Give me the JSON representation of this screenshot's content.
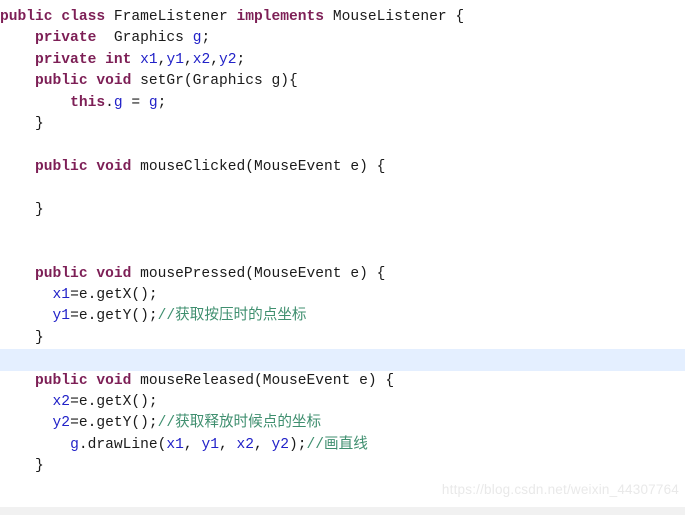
{
  "editor": {
    "language": "Java",
    "background_color": "#ffffff",
    "highlight_row_color": "#e4efff",
    "keyword_color": "#7d1f56",
    "variable_color": "#2222c8",
    "comment_color": "#3f8f6f",
    "plain_color": "#1a1a1a",
    "watermark_color": "#e9e9e9",
    "bottom_strip_color": "#f1f1f1",
    "highlighted_line_number": 17
  },
  "watermark": {
    "text": "https://blog.csdn.net/weixin_44307764"
  },
  "code": {
    "lines": [
      {
        "n": 1,
        "highlighted": false,
        "tokens": [
          {
            "t": "public",
            "c": "kw"
          },
          {
            "t": " ",
            "c": "pln"
          },
          {
            "t": "class",
            "c": "kw"
          },
          {
            "t": " FrameListener ",
            "c": "pln"
          },
          {
            "t": "implements",
            "c": "kw"
          },
          {
            "t": " MouseListener {",
            "c": "pln"
          }
        ]
      },
      {
        "n": 2,
        "highlighted": false,
        "tokens": [
          {
            "t": "    ",
            "c": "pln"
          },
          {
            "t": "private",
            "c": "kw"
          },
          {
            "t": "  Graphics ",
            "c": "pln"
          },
          {
            "t": "g",
            "c": "var"
          },
          {
            "t": ";",
            "c": "pln"
          }
        ]
      },
      {
        "n": 3,
        "highlighted": false,
        "tokens": [
          {
            "t": "    ",
            "c": "pln"
          },
          {
            "t": "private",
            "c": "kw"
          },
          {
            "t": " ",
            "c": "pln"
          },
          {
            "t": "int",
            "c": "kw"
          },
          {
            "t": " ",
            "c": "pln"
          },
          {
            "t": "x1",
            "c": "var"
          },
          {
            "t": ",",
            "c": "pln"
          },
          {
            "t": "y1",
            "c": "var"
          },
          {
            "t": ",",
            "c": "pln"
          },
          {
            "t": "x2",
            "c": "var"
          },
          {
            "t": ",",
            "c": "pln"
          },
          {
            "t": "y2",
            "c": "var"
          },
          {
            "t": ";",
            "c": "pln"
          }
        ]
      },
      {
        "n": 4,
        "highlighted": false,
        "tokens": [
          {
            "t": "    ",
            "c": "pln"
          },
          {
            "t": "public",
            "c": "kw"
          },
          {
            "t": " ",
            "c": "pln"
          },
          {
            "t": "void",
            "c": "kw"
          },
          {
            "t": " setGr(Graphics g){",
            "c": "pln"
          }
        ]
      },
      {
        "n": 5,
        "highlighted": false,
        "tokens": [
          {
            "t": "        ",
            "c": "pln"
          },
          {
            "t": "this",
            "c": "kw"
          },
          {
            "t": ".",
            "c": "pln"
          },
          {
            "t": "g",
            "c": "var"
          },
          {
            "t": " = ",
            "c": "pln"
          },
          {
            "t": "g",
            "c": "var"
          },
          {
            "t": ";",
            "c": "pln"
          }
        ]
      },
      {
        "n": 6,
        "highlighted": false,
        "tokens": [
          {
            "t": "    }",
            "c": "pln"
          }
        ]
      },
      {
        "n": 7,
        "highlighted": false,
        "tokens": [
          {
            "t": "",
            "c": "pln"
          }
        ]
      },
      {
        "n": 8,
        "highlighted": false,
        "tokens": [
          {
            "t": "    ",
            "c": "pln"
          },
          {
            "t": "public",
            "c": "kw"
          },
          {
            "t": " ",
            "c": "pln"
          },
          {
            "t": "void",
            "c": "kw"
          },
          {
            "t": " mouseClicked(MouseEvent e) {",
            "c": "pln"
          }
        ]
      },
      {
        "n": 9,
        "highlighted": false,
        "tokens": [
          {
            "t": "",
            "c": "pln"
          }
        ]
      },
      {
        "n": 10,
        "highlighted": false,
        "tokens": [
          {
            "t": "    }",
            "c": "pln"
          }
        ]
      },
      {
        "n": 11,
        "highlighted": false,
        "tokens": [
          {
            "t": "",
            "c": "pln"
          }
        ]
      },
      {
        "n": 12,
        "highlighted": false,
        "tokens": [
          {
            "t": "",
            "c": "pln"
          }
        ]
      },
      {
        "n": 13,
        "highlighted": false,
        "tokens": [
          {
            "t": "    ",
            "c": "pln"
          },
          {
            "t": "public",
            "c": "kw"
          },
          {
            "t": " ",
            "c": "pln"
          },
          {
            "t": "void",
            "c": "kw"
          },
          {
            "t": " mousePressed(MouseEvent e) {",
            "c": "pln"
          }
        ]
      },
      {
        "n": 14,
        "highlighted": false,
        "tokens": [
          {
            "t": "      ",
            "c": "pln"
          },
          {
            "t": "x1",
            "c": "var"
          },
          {
            "t": "=e.getX();",
            "c": "pln"
          }
        ]
      },
      {
        "n": 15,
        "highlighted": false,
        "tokens": [
          {
            "t": "      ",
            "c": "pln"
          },
          {
            "t": "y1",
            "c": "var"
          },
          {
            "t": "=e.getY();",
            "c": "pln"
          },
          {
            "t": "//获取按压时的点坐标",
            "c": "cmt"
          }
        ]
      },
      {
        "n": 16,
        "highlighted": false,
        "tokens": [
          {
            "t": "    }",
            "c": "pln"
          }
        ]
      },
      {
        "n": 17,
        "highlighted": true,
        "tokens": [
          {
            "t": "",
            "c": "pln"
          }
        ]
      },
      {
        "n": 18,
        "highlighted": false,
        "tokens": [
          {
            "t": "    ",
            "c": "pln"
          },
          {
            "t": "public",
            "c": "kw"
          },
          {
            "t": " ",
            "c": "pln"
          },
          {
            "t": "void",
            "c": "kw"
          },
          {
            "t": " mouseReleased(MouseEvent e) {",
            "c": "pln"
          }
        ]
      },
      {
        "n": 19,
        "highlighted": false,
        "tokens": [
          {
            "t": "      ",
            "c": "pln"
          },
          {
            "t": "x2",
            "c": "var"
          },
          {
            "t": "=e.getX();",
            "c": "pln"
          }
        ]
      },
      {
        "n": 20,
        "highlighted": false,
        "tokens": [
          {
            "t": "      ",
            "c": "pln"
          },
          {
            "t": "y2",
            "c": "var"
          },
          {
            "t": "=e.getY();",
            "c": "pln"
          },
          {
            "t": "//获取释放时候点的坐标",
            "c": "cmt"
          }
        ]
      },
      {
        "n": 21,
        "highlighted": false,
        "tokens": [
          {
            "t": "        ",
            "c": "pln"
          },
          {
            "t": "g",
            "c": "var"
          },
          {
            "t": ".drawLine(",
            "c": "pln"
          },
          {
            "t": "x1",
            "c": "var"
          },
          {
            "t": ", ",
            "c": "pln"
          },
          {
            "t": "y1",
            "c": "var"
          },
          {
            "t": ", ",
            "c": "pln"
          },
          {
            "t": "x2",
            "c": "var"
          },
          {
            "t": ", ",
            "c": "pln"
          },
          {
            "t": "y2",
            "c": "var"
          },
          {
            "t": ");",
            "c": "pln"
          },
          {
            "t": "//画直线",
            "c": "cmt"
          }
        ]
      },
      {
        "n": 22,
        "highlighted": false,
        "tokens": [
          {
            "t": "    }",
            "c": "pln"
          }
        ]
      }
    ]
  }
}
